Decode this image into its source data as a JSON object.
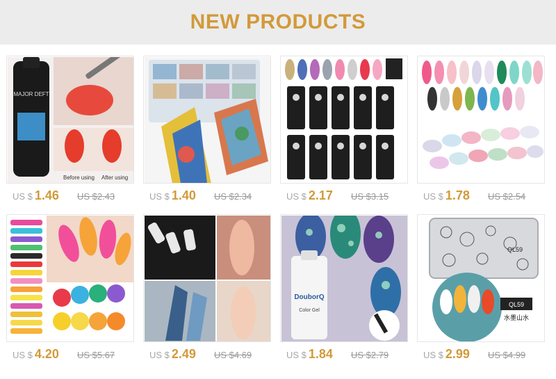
{
  "banner": {
    "title": "NEW PRODUCTS"
  },
  "products": [
    {
      "currency": "US $",
      "price": "1.46",
      "old_price": "US $2.43",
      "image_text": [
        "MAJOR DEFT",
        "Before using",
        "After using"
      ]
    },
    {
      "currency": "US $",
      "price": "1.40",
      "old_price": "US $2.34",
      "image_text": []
    },
    {
      "currency": "US $",
      "price": "2.17",
      "old_price": "US $3.15",
      "image_text": []
    },
    {
      "currency": "US $",
      "price": "1.78",
      "old_price": "US $2.54",
      "image_text": []
    },
    {
      "currency": "US $",
      "price": "4.20",
      "old_price": "US $5.67",
      "image_text": []
    },
    {
      "currency": "US $",
      "price": "2.49",
      "old_price": "US $4.69",
      "image_text": []
    },
    {
      "currency": "US $",
      "price": "1.84",
      "old_price": "US $2.79",
      "image_text": [
        "DouborQ",
        "Color Gel"
      ]
    },
    {
      "currency": "US $",
      "price": "2.99",
      "old_price": "US $4.99",
      "image_text": [
        "QL59",
        "QL59",
        "水墨山水"
      ]
    }
  ],
  "colors": {
    "accent": "#d29a3a",
    "banner_bg": "#ececec",
    "old_price": "#9a9a9a"
  }
}
